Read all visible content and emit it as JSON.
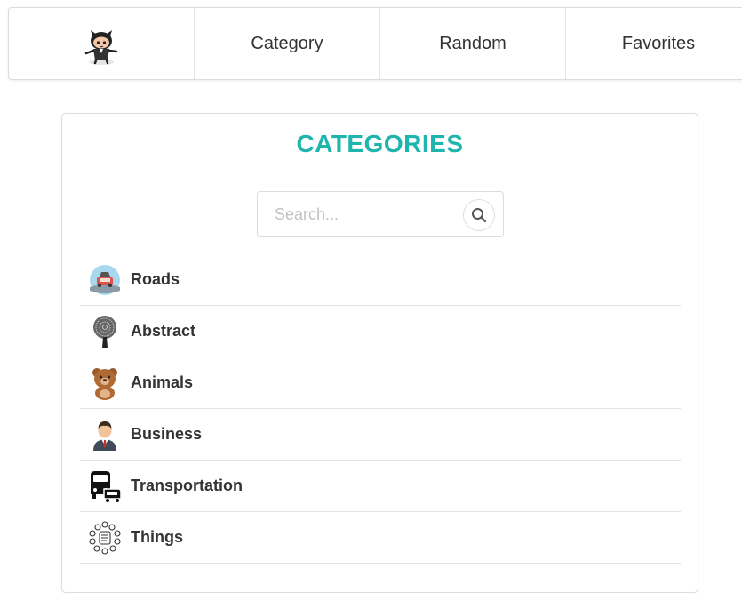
{
  "nav": {
    "logo_icon": "octocat-icon",
    "items": [
      {
        "label": "Category"
      },
      {
        "label": "Random"
      },
      {
        "label": "Favorites"
      }
    ]
  },
  "card": {
    "title": "CATEGORIES",
    "search": {
      "placeholder": "Search...",
      "value": "",
      "icon": "search-icon"
    },
    "categories": [
      {
        "label": "Roads",
        "icon": "road-car-icon"
      },
      {
        "label": "Abstract",
        "icon": "tree-icon"
      },
      {
        "label": "Animals",
        "icon": "bear-icon"
      },
      {
        "label": "Business",
        "icon": "businessman-icon"
      },
      {
        "label": "Transportation",
        "icon": "vehicles-icon"
      },
      {
        "label": "Things",
        "icon": "objects-icon"
      }
    ]
  },
  "colors": {
    "accent": "#1eb5ac",
    "text": "#333333",
    "border": "#dcdcdc",
    "placeholder": "#c2c2c2"
  }
}
